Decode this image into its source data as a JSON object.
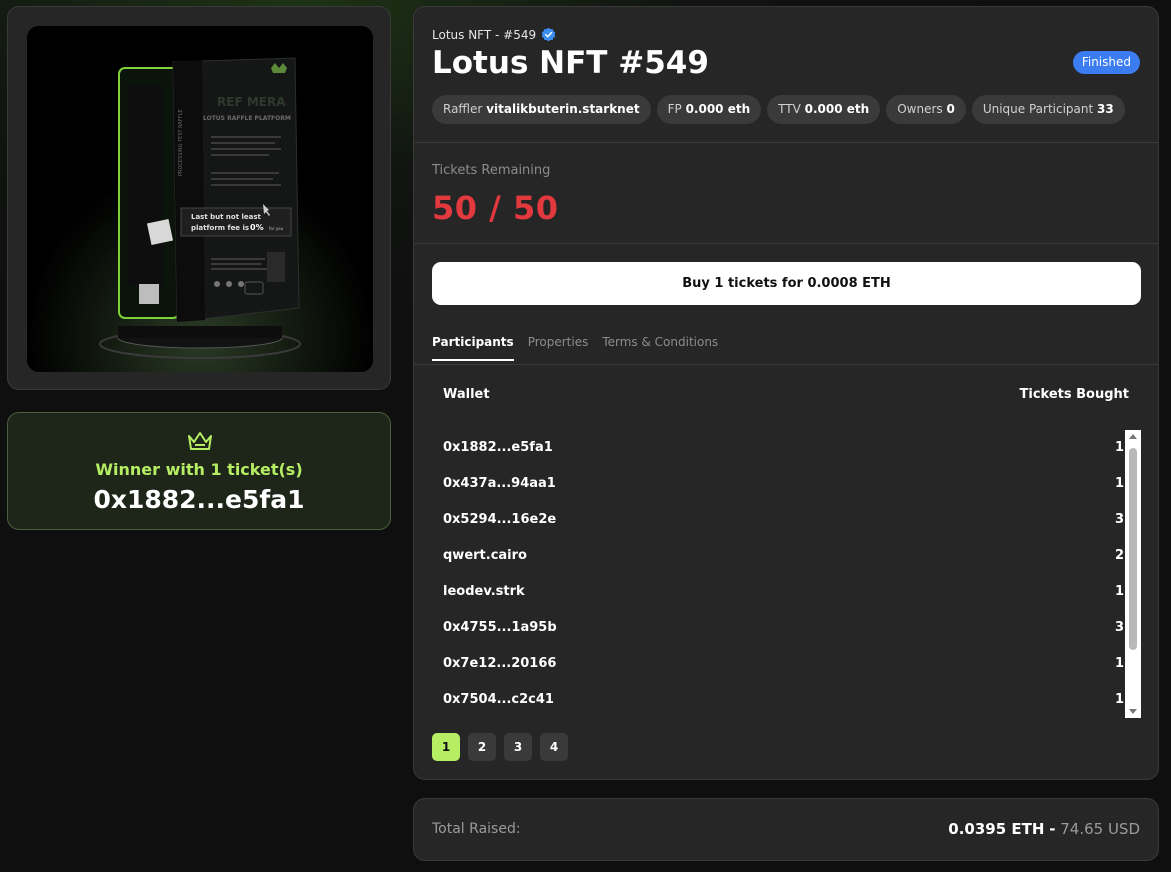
{
  "winner": {
    "label": "Winner with 1 ticket(s)",
    "address": "0x1882...e5fa1",
    "accent_color": "#b6ee63",
    "icon": "crown-icon"
  },
  "nft_image": {
    "card_heading": "REF MERA",
    "card_subheading": "LOTUS RAFFLE PLATFORM",
    "card_spine": "PROCESSING TEST RAFFLE",
    "card_note_line1": "Last but not least",
    "card_note_line2": "platform fee is",
    "card_note_highlight": "0%",
    "card_note_suffix": "for you"
  },
  "header": {
    "collection": "Lotus NFT - #549",
    "title": "Lotus NFT #549",
    "status": "Finished",
    "status_color": "#3b7cf0",
    "verified_icon": "verified-badge-icon"
  },
  "chips": [
    {
      "label": "Raffler",
      "value": "vitalikbuterin.starknet"
    },
    {
      "label": "FP",
      "value": "0.000 eth"
    },
    {
      "label": "TTV",
      "value": "0.000 eth"
    },
    {
      "label": "Owners",
      "value": "0"
    },
    {
      "label": "Unique Participant",
      "value": "33"
    }
  ],
  "tickets": {
    "label": "Tickets Remaining",
    "value": "50 / 50",
    "color": "#e2393f"
  },
  "buy_button": {
    "label": "Buy 1 tickets for 0.0008 ETH"
  },
  "tabs": [
    {
      "label": "Participants",
      "active": true
    },
    {
      "label": "Properties",
      "active": false
    },
    {
      "label": "Terms & Conditions",
      "active": false
    }
  ],
  "table": {
    "headers": {
      "wallet": "Wallet",
      "tickets": "Tickets Bought"
    },
    "rows": [
      {
        "wallet": "0x1882...e5fa1",
        "tickets": "1"
      },
      {
        "wallet": "0x437a...94aa1",
        "tickets": "1"
      },
      {
        "wallet": "0x5294...16e2e",
        "tickets": "3"
      },
      {
        "wallet": "qwert.cairo",
        "tickets": "2"
      },
      {
        "wallet": "leodev.strk",
        "tickets": "1"
      },
      {
        "wallet": "0x4755...1a95b",
        "tickets": "3"
      },
      {
        "wallet": "0x7e12...20166",
        "tickets": "1"
      },
      {
        "wallet": "0x7504...c2c41",
        "tickets": "1"
      }
    ]
  },
  "pagination": {
    "pages": [
      "1",
      "2",
      "3",
      "4"
    ],
    "current": "1"
  },
  "total": {
    "label": "Total Raised:",
    "eth": "0.0395 ETH",
    "separator": "-",
    "usd": "74.65 USD"
  }
}
